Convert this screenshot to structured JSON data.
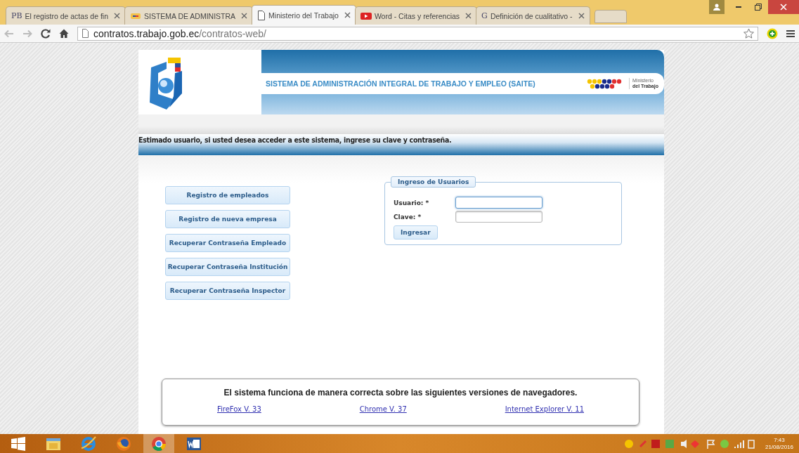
{
  "browser": {
    "tabs": [
      {
        "kind": "letters",
        "favicon_text": "PB",
        "title": "El registro de actas de fin",
        "selected": false
      },
      {
        "kind": "flag",
        "title": "SISTEMA DE ADMINISTRA",
        "selected": false
      },
      {
        "kind": "page",
        "title": "Ministerio del Trabajo",
        "selected": true
      },
      {
        "kind": "video",
        "title": "Word - Citas y referencias",
        "selected": false
      },
      {
        "kind": "letters",
        "favicon_text": "G",
        "title": "Definición de cualitativo -",
        "selected": false
      }
    ],
    "address": {
      "host": "contratos.trabajo.gob.ec",
      "path": "/contratos-web/"
    }
  },
  "header": {
    "title": "SISTEMA DE ADMINISTRACIÓN INTEGRAL DE TRABAJO Y EMPLEO (SAITE)",
    "ministry_line_1": "Ministerio",
    "ministry_line_2": "del Trabajo"
  },
  "message": "Estimado usuario, si usted desea acceder a este sistema, ingrese su clave y contraseña.",
  "side_buttons": [
    "Registro de empleados",
    "Registro de nueva empresa",
    "Recuperar Contraseña Empleado",
    "Recuperar Contraseña Institución",
    "Recuperar Contraseña Inspector"
  ],
  "login": {
    "legend": "Ingreso de Usuarios",
    "fields": [
      {
        "label": "Usuario: *",
        "focused": true
      },
      {
        "label": "Clave: *",
        "focused": false
      }
    ],
    "submit": "Ingresar"
  },
  "footer": {
    "notice": "El sistema funciona de manera correcta sobre las siguientes versiones de navegadores.",
    "links": [
      "FireFox V. 33",
      "Chrome V. 37",
      "Internet Explorer V. 11"
    ]
  },
  "taskbar": {
    "apps": [
      {
        "kind": "explorer",
        "selected": false
      },
      {
        "kind": "ie",
        "selected": false
      },
      {
        "kind": "firefox",
        "selected": false
      },
      {
        "kind": "chrome",
        "selected": true
      },
      {
        "kind": "word",
        "selected": false
      }
    ],
    "time": "7:43",
    "date": "21/08/2016"
  }
}
